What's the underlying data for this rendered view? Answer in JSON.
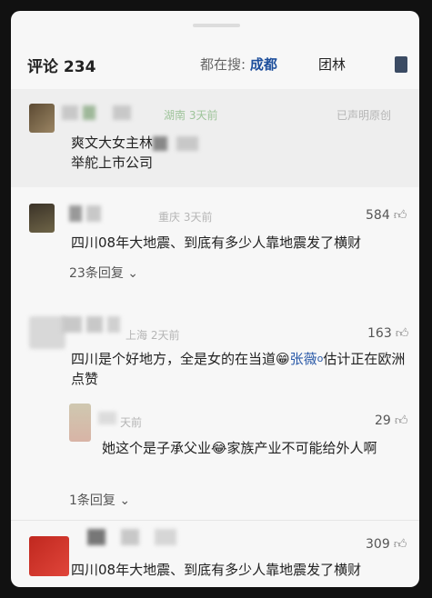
{
  "header": {
    "title": "评论 234",
    "search_prefix": "都在搜: ",
    "search_term": "成都",
    "search_more": "团林"
  },
  "comments": [
    {
      "location_time": "湖南 3天前",
      "right_meta": "已声明原创",
      "text_line1": "爽文大女主林",
      "text_line2": "举舵上市公司"
    },
    {
      "location_time": "重庆 3天前",
      "likes": "584",
      "text": "四川08年大地震、到底有多少人靠地震发了横财",
      "replies": "23条回复"
    },
    {
      "location_time": "上海 2天前",
      "likes": "163",
      "text_part1": "四川是个好地方，全是女的在当道",
      "emoji": "😁",
      "mention": "张薇",
      "text_part2": "估计正在欧洲点赞",
      "reply": {
        "time": "天前",
        "likes": "29",
        "text_part1": "她这个是子承父业",
        "emoji": "😂",
        "text_part2": "家族产业不可能给外人啊"
      },
      "replies": "1条回复"
    },
    {
      "likes": "309",
      "text": "四川08年大地震、到底有多少人靠地震发了横财"
    }
  ],
  "icons": {
    "like": "thumbs-up-icon",
    "expand": "chevron-down-icon"
  }
}
